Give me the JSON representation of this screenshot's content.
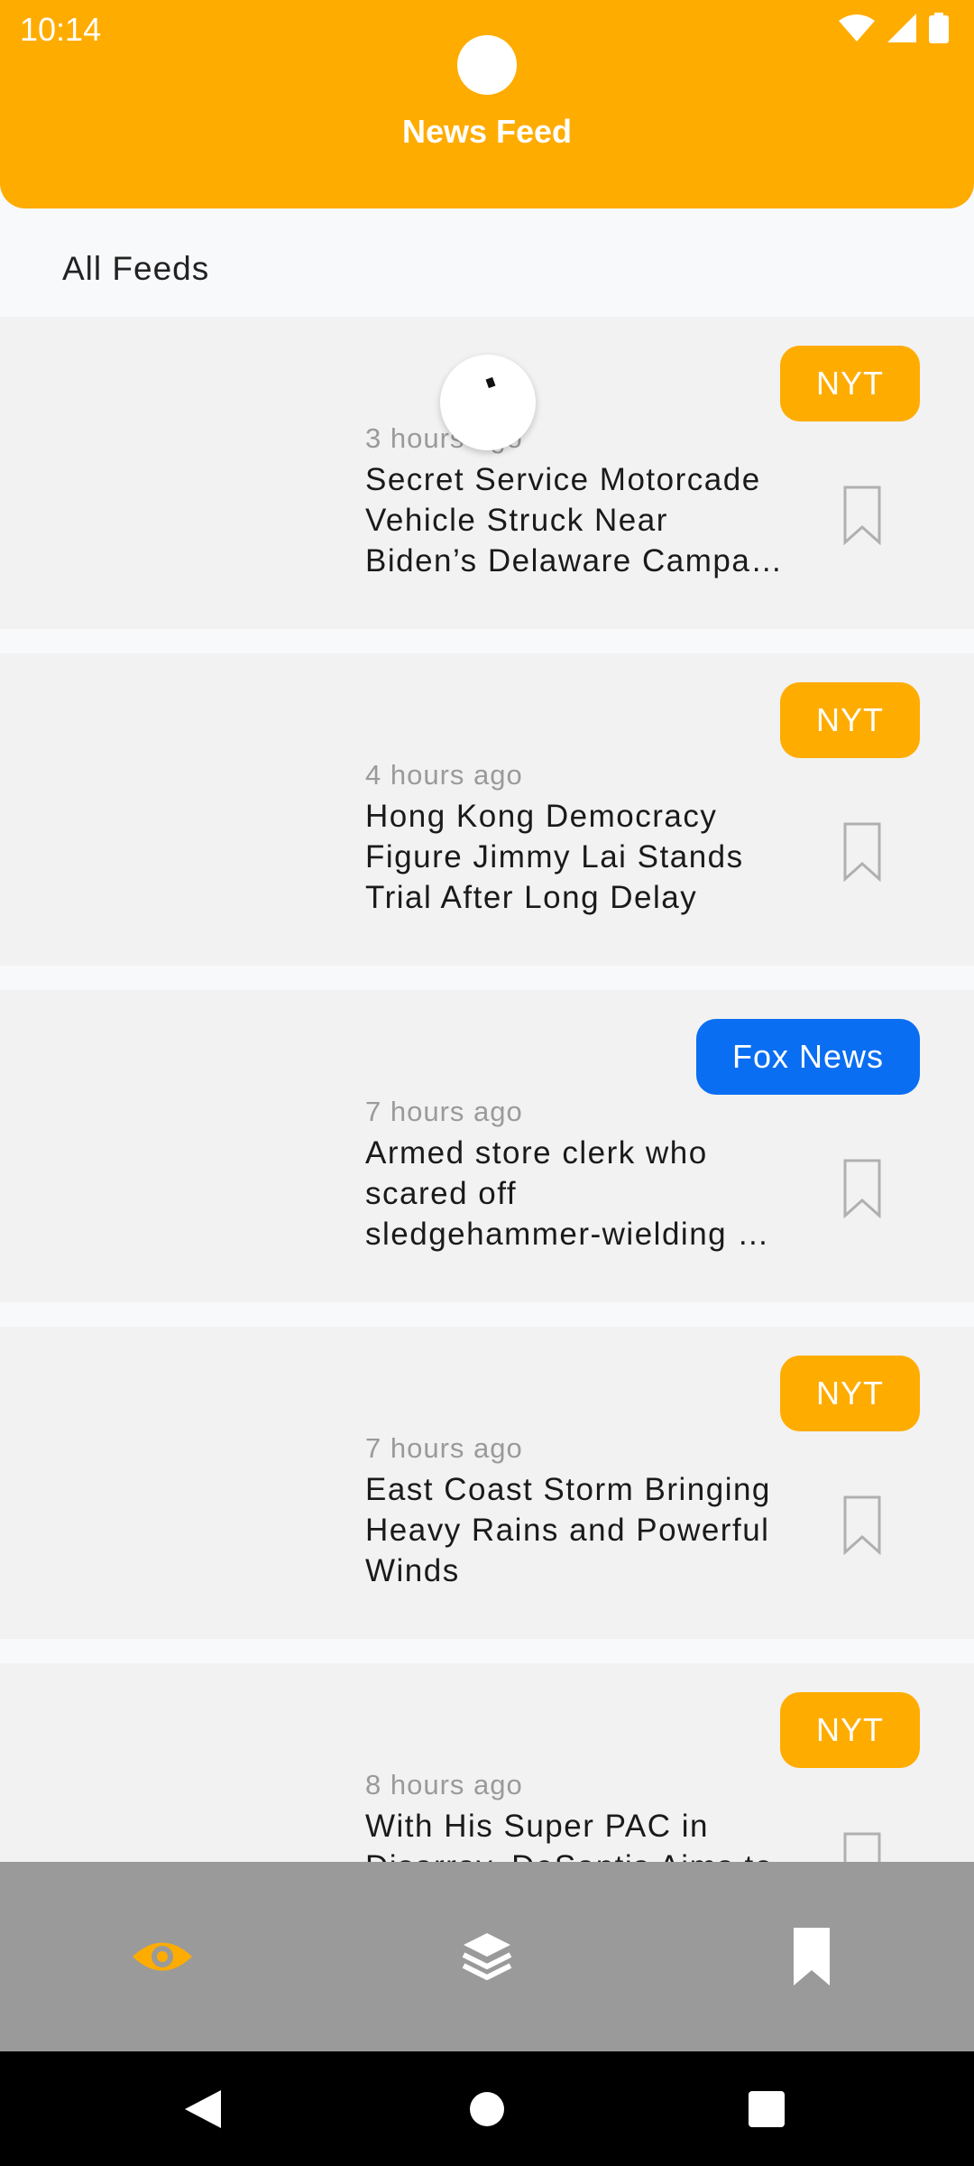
{
  "status_bar": {
    "time": "10:14"
  },
  "header": {
    "title": "News Feed"
  },
  "filter": {
    "label": "All Feeds"
  },
  "colors": {
    "accent": "#FFAC00",
    "fox_blue": "#0A6EF2",
    "nav_bg": "#9A9A9A"
  },
  "feed": [
    {
      "source": "NYT",
      "source_color": "#FFAC00",
      "time": "3 hours ago",
      "title_lines": [
        "Secret Service Motorcade",
        "Vehicle Struck Near",
        "Biden’s Delaware Campa…"
      ]
    },
    {
      "source": "NYT",
      "source_color": "#FFAC00",
      "time": "4 hours ago",
      "title_lines": [
        "Hong Kong Democracy",
        "Figure Jimmy Lai Stands",
        "Trial After Long Delay"
      ]
    },
    {
      "source": "Fox News",
      "source_color": "#0A6EF2",
      "time": "7 hours ago",
      "title_lines": [
        "Armed store clerk who",
        "scared off",
        "sledgehammer-wielding …"
      ]
    },
    {
      "source": "NYT",
      "source_color": "#FFAC00",
      "time": "7 hours ago",
      "title_lines": [
        "East Coast Storm Bringing",
        "Heavy Rains and Powerful",
        "Winds"
      ]
    },
    {
      "source": "NYT",
      "source_color": "#FFAC00",
      "time": "8 hours ago",
      "title_lines": [
        "With His Super PAC in",
        "Disarray, DeSantis Aims to"
      ]
    }
  ],
  "bottom_nav": [
    {
      "icon": "eye-icon",
      "active": true
    },
    {
      "icon": "layers-icon",
      "active": false
    },
    {
      "icon": "bookmark-icon",
      "active": false
    }
  ],
  "system_nav": [
    "back-icon",
    "home-icon",
    "recents-icon"
  ]
}
